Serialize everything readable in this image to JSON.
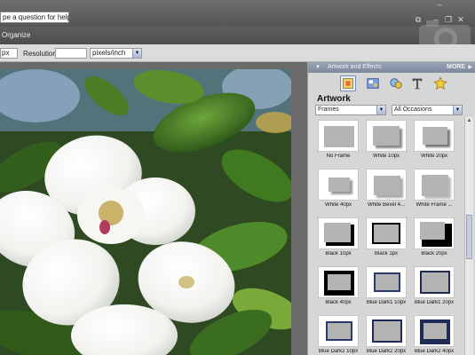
{
  "titlebar": {
    "help_placeholder": "Type a question for help",
    "help_visible_text": "pe a question for help",
    "window_buttons": [
      "minimize-icon",
      "restore-icon",
      "close-icon"
    ]
  },
  "menubar": {
    "organize": "Organize"
  },
  "options": {
    "width_value": "px",
    "resolution_label": "Resolution:",
    "resolution_value": "",
    "unit_value": "pixels/inch"
  },
  "palette": {
    "title": "Artwork and Effects",
    "more_label": "MORE",
    "tools": [
      "artwork-icon",
      "themes-icon",
      "effects-icon",
      "text-icon",
      "favorites-icon"
    ],
    "section_label": "Artwork",
    "category_value": "Frames",
    "occasion_value": "All Occasions",
    "items": [
      {
        "label": "No Frame",
        "style": "none"
      },
      {
        "label": "White 10px",
        "style": "white-shadow"
      },
      {
        "label": "White 20px",
        "style": "white-shadow2"
      },
      {
        "label": "White 40px",
        "style": "white-large"
      },
      {
        "label": "White Bevel 4...",
        "style": "white-bevel"
      },
      {
        "label": "White Frame ...",
        "style": "white-frame"
      },
      {
        "label": "Black 10px",
        "style": "black"
      },
      {
        "label": "Black 1px",
        "style": "black1"
      },
      {
        "label": "Black 20px",
        "style": "black20"
      },
      {
        "label": "Black 40px",
        "style": "black40"
      },
      {
        "label": "Blue Dark1 10px",
        "style": "blue1"
      },
      {
        "label": "Blue Dark1 20px",
        "style": "blue2"
      },
      {
        "label": "Blue Dark2 10px",
        "style": "blue3"
      },
      {
        "label": "Blue Dark2 20px",
        "style": "blue4"
      },
      {
        "label": "Blue Dark2 40px",
        "style": "blue5"
      }
    ]
  },
  "colors": {
    "accent": "#7d889c",
    "canvas_bg": "#6a6a6a",
    "palette_bg": "#d6d6d6"
  }
}
